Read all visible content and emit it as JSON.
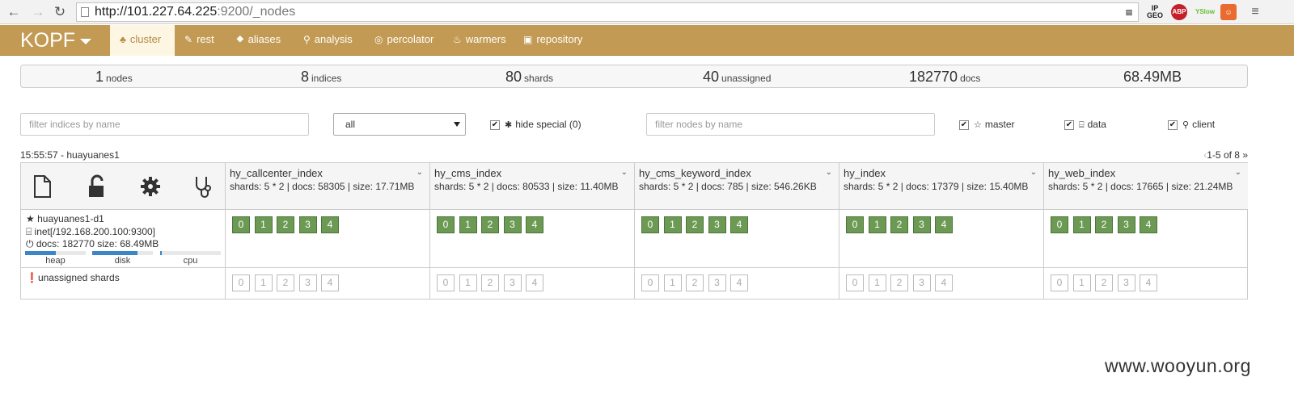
{
  "browser": {
    "url_host": "http://101.227.64.225",
    "url_rest": ":9200/_nodes",
    "extensions": [
      "IP GEO",
      "ABP",
      "YSlow",
      "shell"
    ]
  },
  "navbar": {
    "brand": "KOPF",
    "items": [
      {
        "label": "cluster",
        "icon": "cluster-icon",
        "active": true
      },
      {
        "label": "rest",
        "icon": "edit-icon"
      },
      {
        "label": "aliases",
        "icon": "tags-icon"
      },
      {
        "label": "analysis",
        "icon": "sitemap-icon"
      },
      {
        "label": "percolator",
        "icon": "percolator-icon"
      },
      {
        "label": "warmers",
        "icon": "fire-icon"
      },
      {
        "label": "repository",
        "icon": "briefcase-icon"
      }
    ]
  },
  "stats": {
    "nodes": {
      "value": "1",
      "label": "nodes"
    },
    "indices": {
      "value": "8",
      "label": "indices"
    },
    "shards": {
      "value": "80",
      "label": "shards"
    },
    "unassigned": {
      "value": "40",
      "label": "unassigned"
    },
    "docs": {
      "value": "182770",
      "label": "docs"
    },
    "size": {
      "value": "68.49MB"
    }
  },
  "filters": {
    "indices_placeholder": "filter indices by name",
    "select_value": "all",
    "hide_special": "hide special (0)",
    "nodes_placeholder": "filter nodes by name",
    "master": "master",
    "data": "data",
    "client": "client"
  },
  "header": {
    "clock": "15:55:57 - huayuanes1",
    "pager_prev": "‹",
    "pager_text": "1-5 of 8",
    "pager_next": "»"
  },
  "indices": [
    {
      "name": "hy_callcenter_index",
      "stats": "shards: 5 * 2 | docs: 58305 | size: 17.71MB"
    },
    {
      "name": "hy_cms_index",
      "stats": "shards: 5 * 2 | docs: 80533 | size: 11.40MB"
    },
    {
      "name": "hy_cms_keyword_index",
      "stats": "shards: 5 * 2 | docs: 785 | size: 546.26KB"
    },
    {
      "name": "hy_index",
      "stats": "shards: 5 * 2 | docs: 17379 | size: 15.40MB"
    },
    {
      "name": "hy_web_index",
      "stats": "shards: 5 * 2 | docs: 17665 | size: 21.24MB"
    }
  ],
  "shards": [
    "0",
    "1",
    "2",
    "3",
    "4"
  ],
  "node": {
    "name": "huayuanes1-d1",
    "address": "inet[/192.168.200.100:9300]",
    "docs": "docs: 182770 size: 68.49MB",
    "heap_label": "heap",
    "disk_label": "disk",
    "cpu_label": "cpu",
    "heap_fraction": 0.5,
    "disk_fraction": 0.75,
    "cpu_fraction": 0.03
  },
  "unassigned_label": "unassigned shards",
  "watermark": "www.wooyun.org",
  "colors": {
    "navbar": "#c39a53",
    "shard_started": "#6c9a54",
    "bar_fill": "#3b86c6"
  }
}
